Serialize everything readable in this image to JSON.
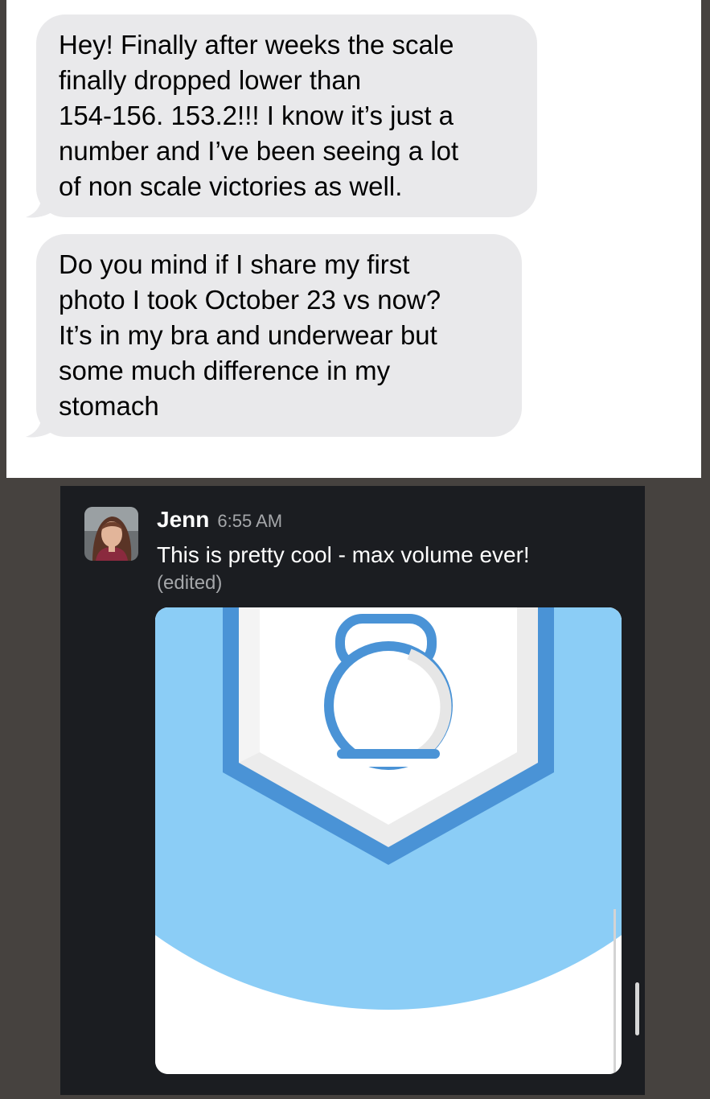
{
  "imessage": {
    "bubbles": [
      {
        "text": "Hey! Finally after weeks the scale\nfinally dropped lower than\n154-156. 153.2!!! I know it’s just a\nnumber and I’ve been seeing a lot\nof non scale victories as well."
      },
      {
        "text": "Do you mind if I share my first\nphoto I took October 23 vs now?\nIt’s in my bra and underwear but\nsome much difference in my\nstomach"
      }
    ],
    "colors": {
      "bubble_bg": "#e9e9eb",
      "panel_bg": "#ffffff"
    }
  },
  "slack": {
    "author": "Jenn",
    "timestamp": "6:55 AM",
    "message": "This is pretty cool - max volume ever!",
    "edited_label": "(edited)",
    "attachment": {
      "icon": "kettlebell-badge-icon",
      "colors": {
        "sky": "#8bcdf6",
        "badge_border": "#4a93d6",
        "badge_fill": "#ffffff"
      }
    },
    "colors": {
      "panel_bg": "#1b1d21",
      "outer_bg": "#46423f"
    }
  }
}
